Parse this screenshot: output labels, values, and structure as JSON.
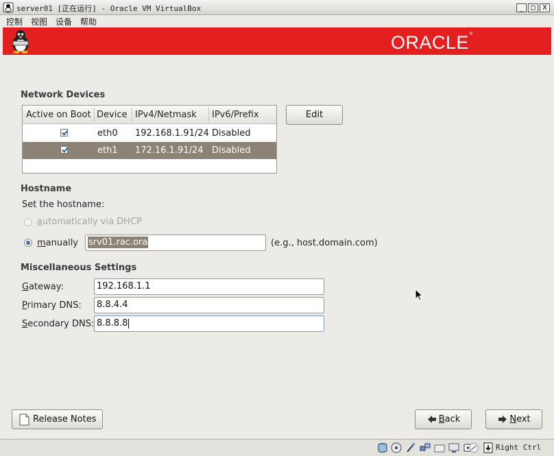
{
  "window": {
    "title": "server01 [正在运行] - Oracle VM VirtualBox",
    "minimize": "_",
    "maximize": "□",
    "close": "X"
  },
  "menu": [
    "控制",
    "视图",
    "设备",
    "帮助"
  ],
  "banner": {
    "logo_text": "ORACLE",
    "logo_mark": "®"
  },
  "network": {
    "title": "Network Devices",
    "headers": [
      "Active on Boot",
      "Device",
      "IPv4/Netmask",
      "IPv6/Prefix"
    ],
    "rows": [
      {
        "active": true,
        "device": "eth0",
        "ipv4": "192.168.1.91/24",
        "ipv6": "Disabled",
        "selected": false
      },
      {
        "active": true,
        "device": "eth1",
        "ipv4": "172.16.1.91/24",
        "ipv6": "Disabled",
        "selected": true
      }
    ],
    "edit_label": "Edit"
  },
  "hostname": {
    "title": "Hostname",
    "prompt": "Set the hostname:",
    "dhcp_label_u": "a",
    "dhcp_label_rest": "utomatically via DHCP",
    "manual_label_u": "m",
    "manual_label_rest": "anually",
    "value": "srv01.rac.ora",
    "example": "(e.g., host.domain.com)"
  },
  "misc": {
    "title": "Miscellaneous Settings",
    "gateway_u": "G",
    "gateway_rest": "ateway:",
    "gateway_value": "192.168.1.1",
    "pdns_u": "P",
    "pdns_rest": "rimary DNS:",
    "pdns_value": "8.8.4.4",
    "sdns_u": "S",
    "sdns_rest": "econdary DNS:",
    "sdns_value": "8.8.8.8"
  },
  "buttons": {
    "release_notes": "Release Notes",
    "back_u": "B",
    "back_rest": "ack",
    "next_u": "N",
    "next_rest": "ext"
  },
  "statusbar": {
    "host_key": "Right Ctrl"
  },
  "colors": {
    "banner_red": "#e3201f",
    "selection": "#8c8276"
  }
}
